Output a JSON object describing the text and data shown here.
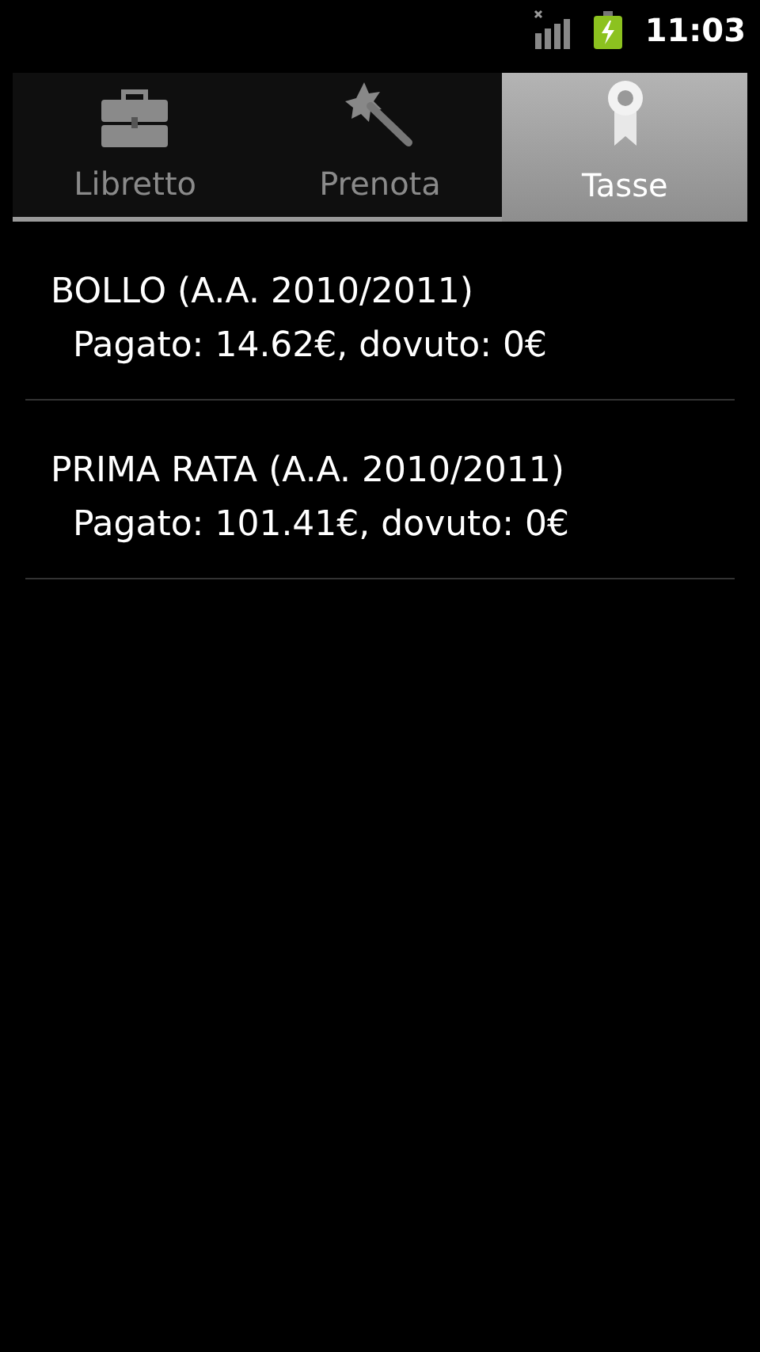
{
  "status_bar": {
    "time": "11:03"
  },
  "tabs": [
    {
      "label": "Libretto",
      "selected": false
    },
    {
      "label": "Prenota",
      "selected": false
    },
    {
      "label": "Tasse",
      "selected": true
    }
  ],
  "items": [
    {
      "title": "BOLLO (A.A. 2010/2011)",
      "detail": "Pagato: 14.62€, dovuto: 0€"
    },
    {
      "title": "PRIMA RATA (A.A. 2010/2011)",
      "detail": "Pagato: 101.41€, dovuto: 0€"
    }
  ]
}
